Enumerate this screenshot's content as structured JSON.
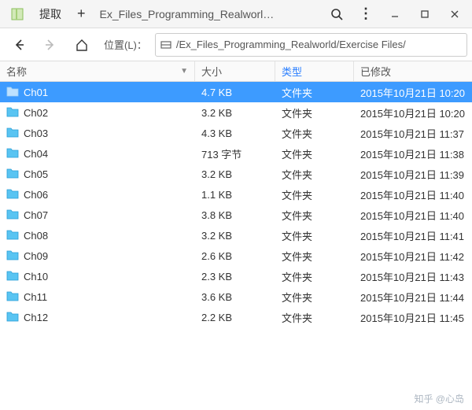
{
  "titlebar": {
    "extract_label": "提取",
    "title": "Ex_Files_Programming_Realworl…"
  },
  "toolbar": {
    "location_label": "位置(L)：",
    "path": "/Ex_Files_Programming_Realworld/Exercise Files/"
  },
  "columns": {
    "name": "名称",
    "size": "大小",
    "type": "类型",
    "modified": "已修改"
  },
  "folder_type_label": "文件夹",
  "rows": [
    {
      "name": "Ch01",
      "size": "4.7 KB",
      "modified": "2015年10月21日 10:20",
      "selected": true
    },
    {
      "name": "Ch02",
      "size": "3.2 KB",
      "modified": "2015年10月21日 10:20",
      "selected": false
    },
    {
      "name": "Ch03",
      "size": "4.3 KB",
      "modified": "2015年10月21日 11:37",
      "selected": false
    },
    {
      "name": "Ch04",
      "size": "713 字节",
      "modified": "2015年10月21日 11:38",
      "selected": false
    },
    {
      "name": "Ch05",
      "size": "3.2 KB",
      "modified": "2015年10月21日 11:39",
      "selected": false
    },
    {
      "name": "Ch06",
      "size": "1.1 KB",
      "modified": "2015年10月21日 11:40",
      "selected": false
    },
    {
      "name": "Ch07",
      "size": "3.8 KB",
      "modified": "2015年10月21日 11:40",
      "selected": false
    },
    {
      "name": "Ch08",
      "size": "3.2 KB",
      "modified": "2015年10月21日 11:41",
      "selected": false
    },
    {
      "name": "Ch09",
      "size": "2.6 KB",
      "modified": "2015年10月21日 11:42",
      "selected": false
    },
    {
      "name": "Ch10",
      "size": "2.3 KB",
      "modified": "2015年10月21日 11:43",
      "selected": false
    },
    {
      "name": "Ch11",
      "size": "3.6 KB",
      "modified": "2015年10月21日 11:44",
      "selected": false
    },
    {
      "name": "Ch12",
      "size": "2.2 KB",
      "modified": "2015年10月21日 11:45",
      "selected": false
    }
  ],
  "watermark": "知乎 @心岛"
}
